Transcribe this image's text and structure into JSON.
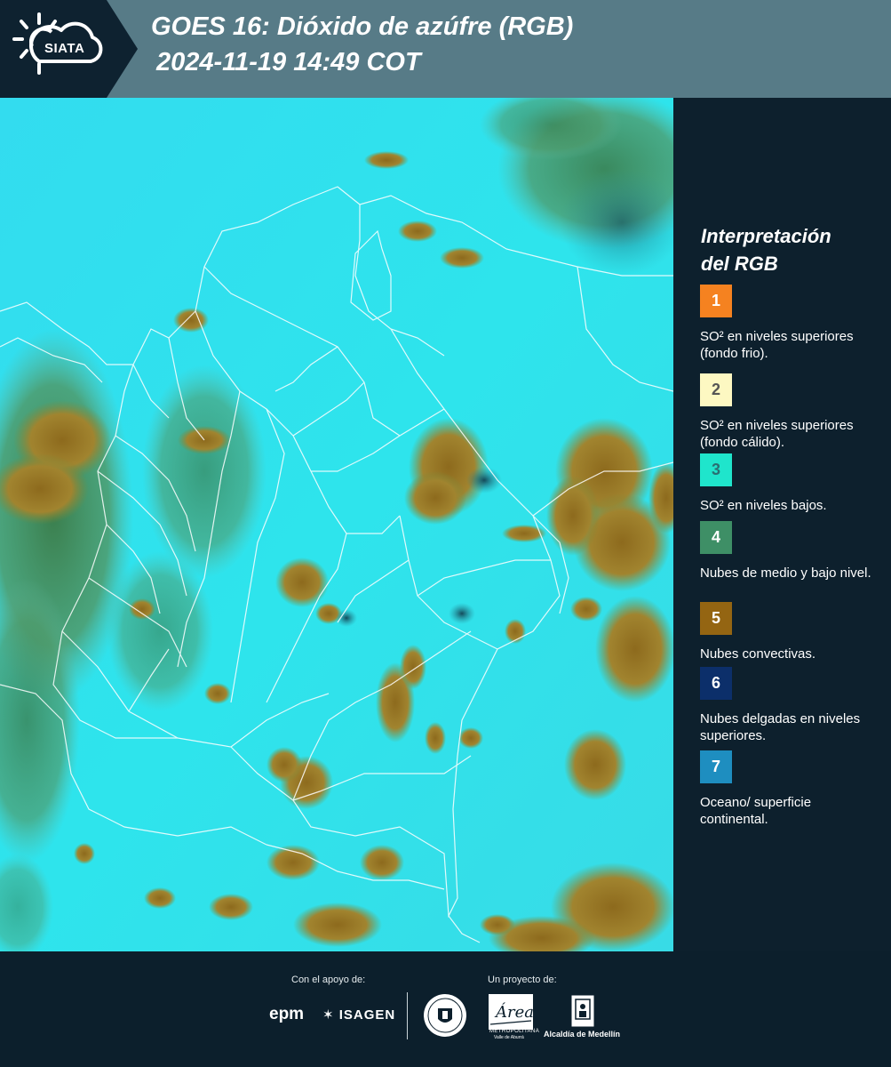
{
  "header": {
    "logo_text": "SIATA",
    "title_line1": "GOES 16: Dióxido de azúfre (RGB)",
    "title_line2": "2024-11-19 14:49 COT"
  },
  "map": {
    "product": "GOES 16 Sulfur Dioxide RGB",
    "colors": {
      "background_cyan": "#2ee0ec",
      "convective_brown": "#9a7a2a",
      "mid_low_green": "#3f8f5a",
      "borders": "#ffffff"
    }
  },
  "legend": {
    "title_line1": "Interpretación",
    "title_line2": "del RGB",
    "items": [
      {
        "number": "1",
        "text": "SO² en niveles superiores (fondo frio).",
        "color": "#f58220",
        "num_color": "#ffffff"
      },
      {
        "number": "2",
        "text": "SO² en niveles superiores (fondo cálido).",
        "color": "#fdf8c2",
        "num_color": "#555555"
      },
      {
        "number": "3",
        "text": "SO² en niveles bajos.",
        "color": "#1fe5cc",
        "num_color": "#2a6f72"
      },
      {
        "number": "4",
        "text": "Nubes de medio y bajo nivel.",
        "color": "#3e8f66",
        "num_color": "#ffffff"
      },
      {
        "number": "5",
        "text": "Nubes convectivas.",
        "color": "#946512",
        "num_color": "#ffffff"
      },
      {
        "number": "6",
        "text": "Nubes delgadas en niveles superiores.",
        "color": "#0c2f6a",
        "num_color": "#ffffff"
      },
      {
        "number": "7",
        "text": "Oceano/ superficie continental.",
        "color": "#1e8ec0",
        "num_color": "#ffffff"
      }
    ]
  },
  "footer": {
    "support_label": "Con el apoyo de:",
    "project_label": "Un proyecto de:",
    "sponsors": [
      "epm",
      "ISAGEN"
    ],
    "partners": {
      "area_name": "Área",
      "area_line": "METROPOLITANA",
      "area_sub": "Valle de Aburrá",
      "alcaldia": "Alcaldía de Medellín"
    }
  }
}
